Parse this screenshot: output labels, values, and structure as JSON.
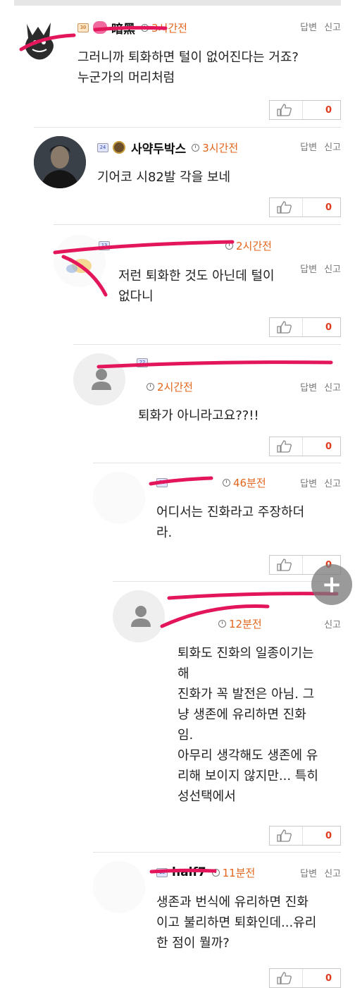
{
  "labels": {
    "reply": "답변",
    "report": "신고"
  },
  "fab": {
    "icon": "plus-icon",
    "label": "+"
  },
  "colors": {
    "time": "#e2651c",
    "count": "#e03a1e",
    "redaction": "#e3165b"
  },
  "comments": [
    {
      "level": "30",
      "nick": "暗黑",
      "time": "3시간전",
      "text": "그러니까 퇴화하면 털이 없어진다는 거죠?\n누군가의 머리처럼",
      "likes": "0"
    },
    {
      "level": "24",
      "nick": "사약두박스",
      "time": "3시간전",
      "text": "기어코 시82발 각을 보네",
      "likes": "0"
    },
    {
      "level": "13",
      "nick": "",
      "time": "2시간전",
      "text": "저런 퇴화한 것도 아닌데 털이\n없다니",
      "likes": "0"
    },
    {
      "level": "22",
      "nick": "",
      "time": "2시간전",
      "text": "퇴화가 아니라고요??!!",
      "likes": "0"
    },
    {
      "level": "18",
      "nick": "",
      "time": "46분전",
      "text": "어디서는 진화라고 주장하더\n라.",
      "likes": "0"
    },
    {
      "level": "",
      "nick": "",
      "time": "12분전",
      "text": "퇴화도 진화의 일종이기는\n해\n진화가 꼭 발전은 아님. 그\n냥 생존에 유리하면 진화\n임.\n아무리 생각해도 생존에 유\n리해 보이지 않지만... 특히\n성선택에서",
      "likes": "0"
    },
    {
      "level": "18",
      "nick": "half7",
      "time": "11분전",
      "text": "생존과 번식에 유리하면 진화\n이고 불리하면 퇴화인데...유리\n한 점이 뭘까?",
      "likes": "0"
    }
  ]
}
